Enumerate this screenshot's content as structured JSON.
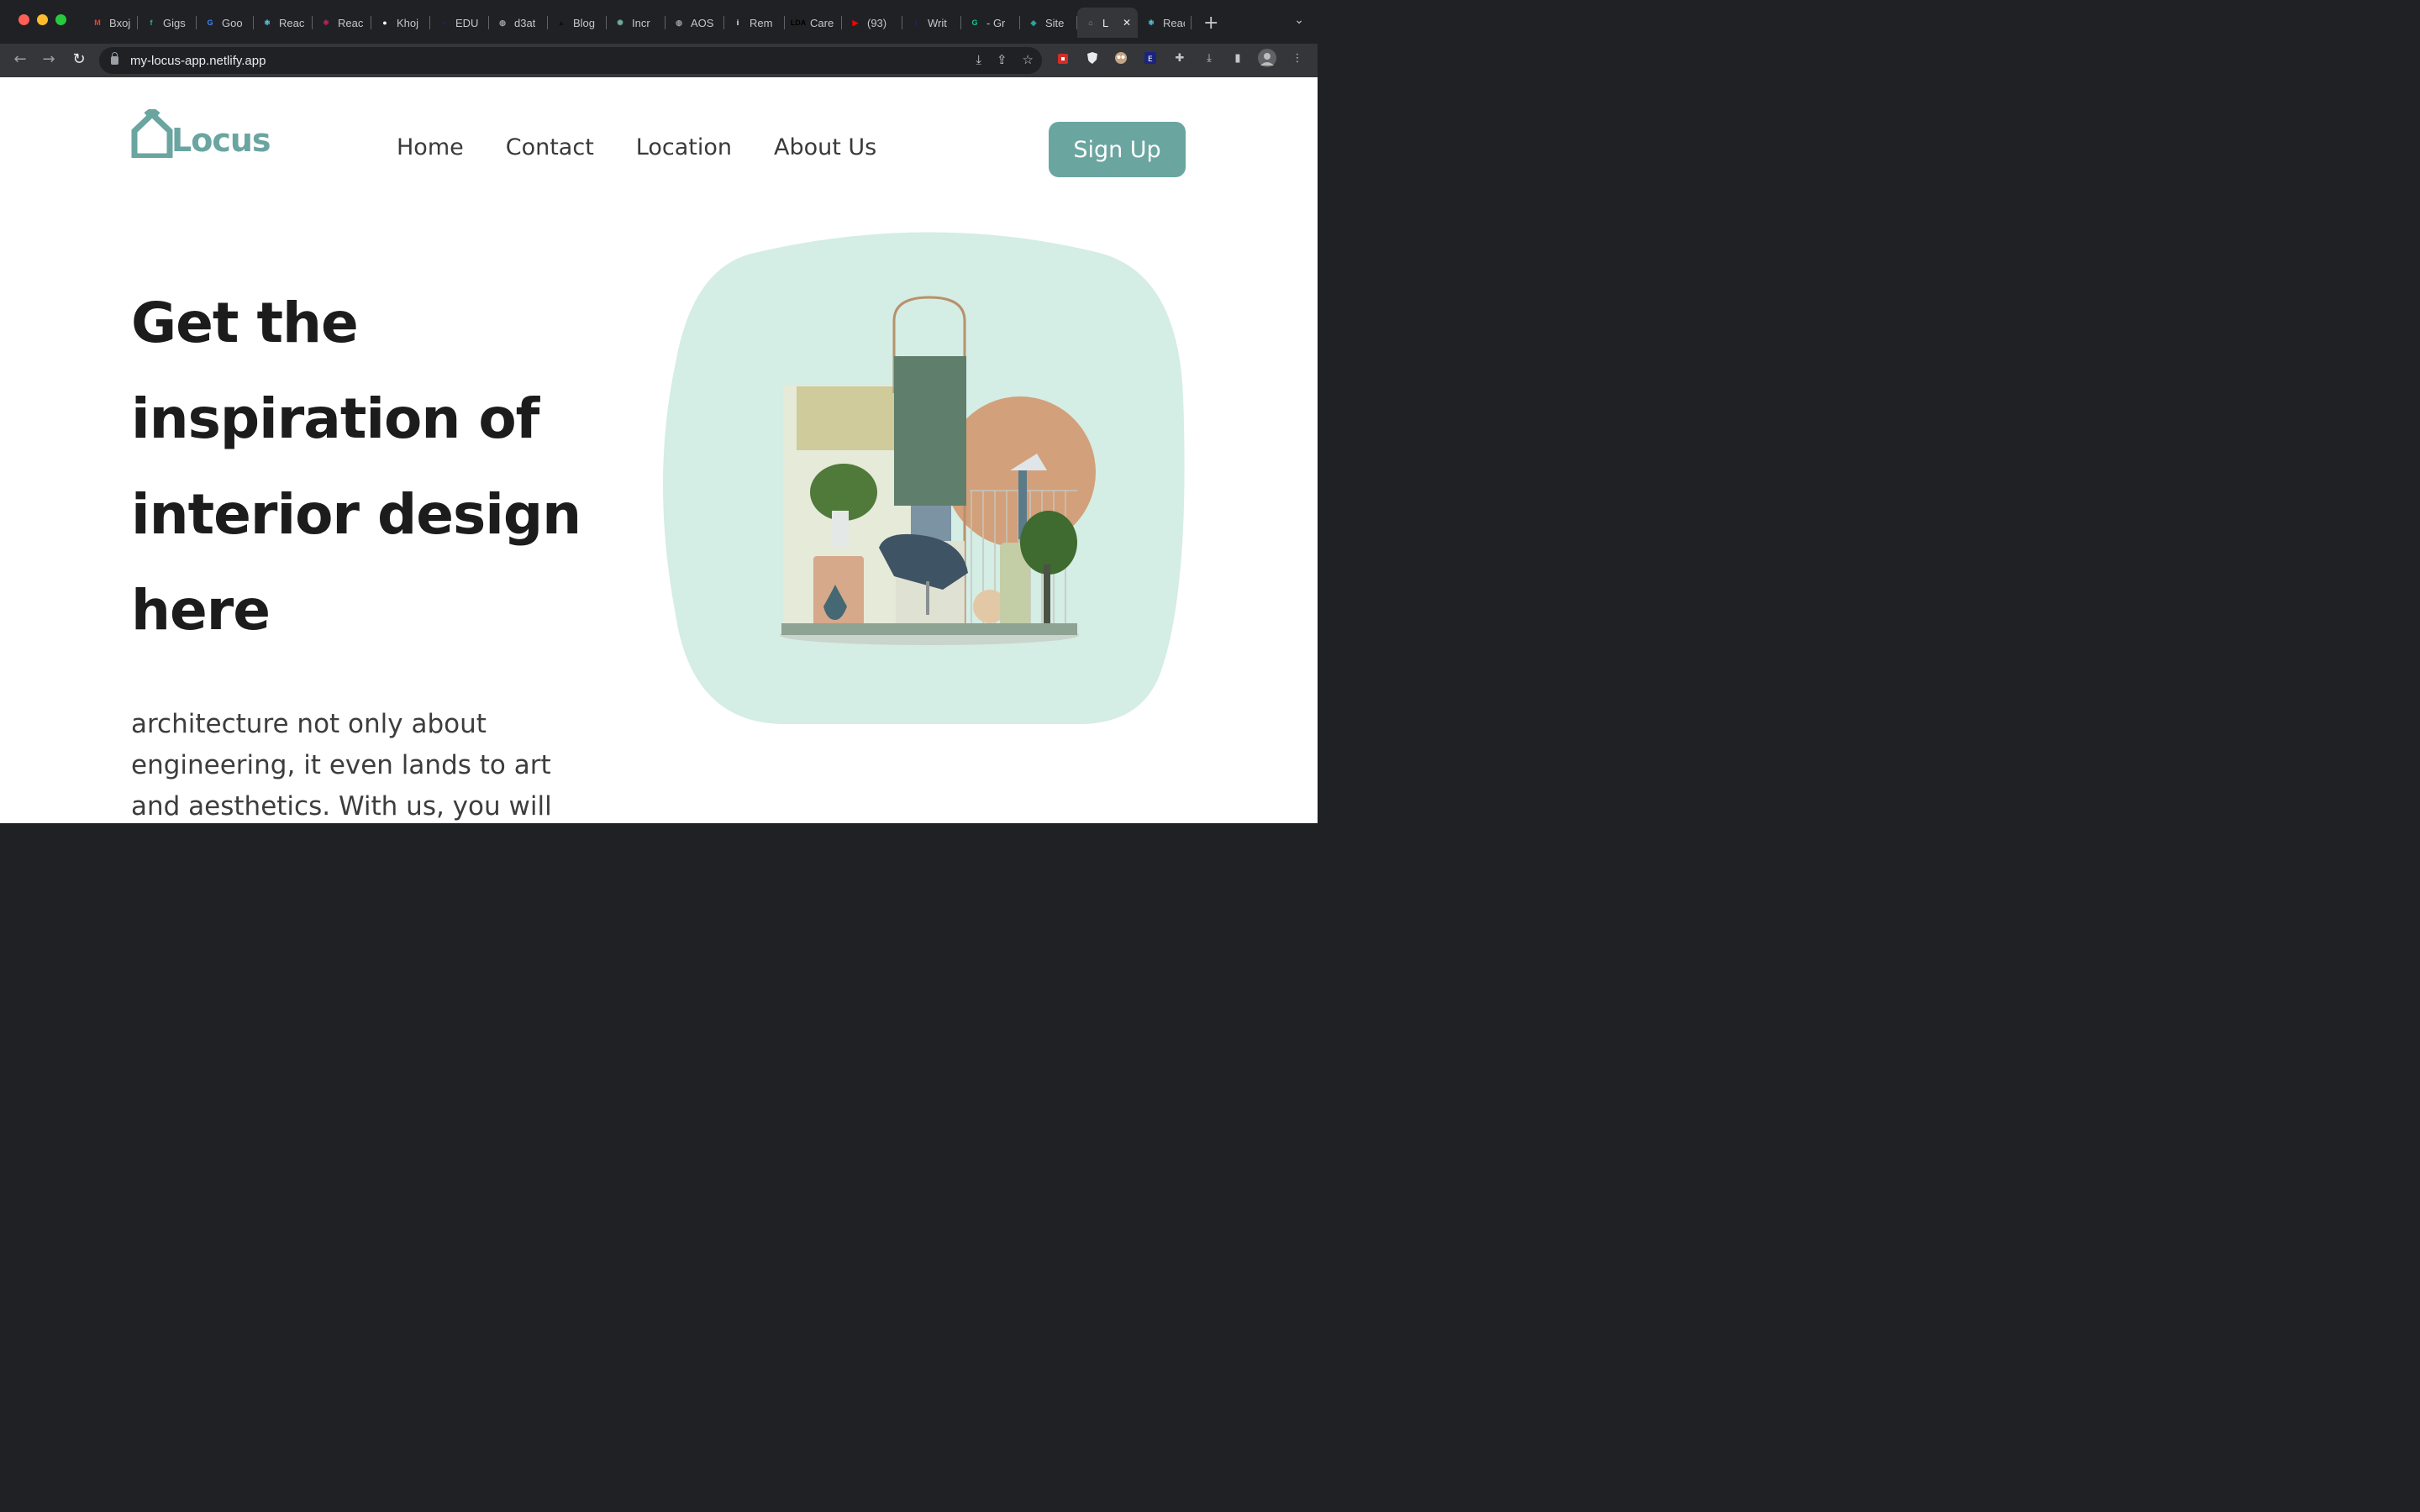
{
  "browser": {
    "tabs": [
      {
        "label": "Bxoj",
        "icon": "gmail-icon",
        "color": "#ea4335",
        "glyph": "M"
      },
      {
        "label": "Gigs",
        "icon": "fiverr-icon",
        "color": "#1dbf73",
        "glyph": "f"
      },
      {
        "label": "Goo",
        "icon": "google-translate-icon",
        "color": "#4285f4",
        "glyph": "G"
      },
      {
        "label": "Reac",
        "icon": "react-icon",
        "color": "#61dafb",
        "glyph": "⚛"
      },
      {
        "label": "Reac",
        "icon": "react-icon",
        "color": "#e0245e",
        "glyph": "⚛"
      },
      {
        "label": "Khoj",
        "icon": "github-icon",
        "color": "#ffffff",
        "glyph": "●"
      },
      {
        "label": "EDU",
        "icon": "edu-icon",
        "color": "#1a237e",
        "glyph": "•"
      },
      {
        "label": "d3at",
        "icon": "globe-icon",
        "color": "#9aa0a6",
        "glyph": "◍"
      },
      {
        "label": "Blog",
        "icon": "blog-icon",
        "color": "#111111",
        "glyph": "▲"
      },
      {
        "label": "Incr",
        "icon": "openai-icon",
        "color": "#74aa9c",
        "glyph": "✺"
      },
      {
        "label": "AOS",
        "icon": "globe-icon",
        "color": "#9aa0a6",
        "glyph": "◍"
      },
      {
        "label": "Rem",
        "icon": "info-icon",
        "color": "#ffffff",
        "glyph": "i"
      },
      {
        "label": "Care",
        "icon": "lda-icon",
        "color": "#000000",
        "glyph": "LDA"
      },
      {
        "label": "(93)",
        "icon": "youtube-icon",
        "color": "#ff0000",
        "glyph": "▶"
      },
      {
        "label": "Writ",
        "icon": "writer-icon",
        "color": "#1a237e",
        "glyph": "i"
      },
      {
        "label": "- Gr",
        "icon": "grammarly-icon",
        "color": "#15c39a",
        "glyph": "G"
      },
      {
        "label": "Site",
        "icon": "site-icon",
        "color": "#26a69a",
        "glyph": "◆"
      },
      {
        "label": "L",
        "icon": "locus-house-icon",
        "color": "#6aa5a0",
        "glyph": "⌂",
        "active": true
      },
      {
        "label": "Reac",
        "icon": "react-icon",
        "color": "#61dafb",
        "glyph": "⚛"
      }
    ],
    "url": "my-locus-app.netlify.app"
  },
  "site": {
    "logo_text": "Locus",
    "brand_color": "#6aa5a0",
    "nav": [
      "Home",
      "Contact",
      "Location",
      "About Us"
    ],
    "signup_label": "Sign Up",
    "headline": "Get the inspiration of interior design here",
    "subtext": "architecture not only about engineering, it even lands to art and aesthetics. With us, you will",
    "hero_bg_color": "#d4ede5"
  }
}
